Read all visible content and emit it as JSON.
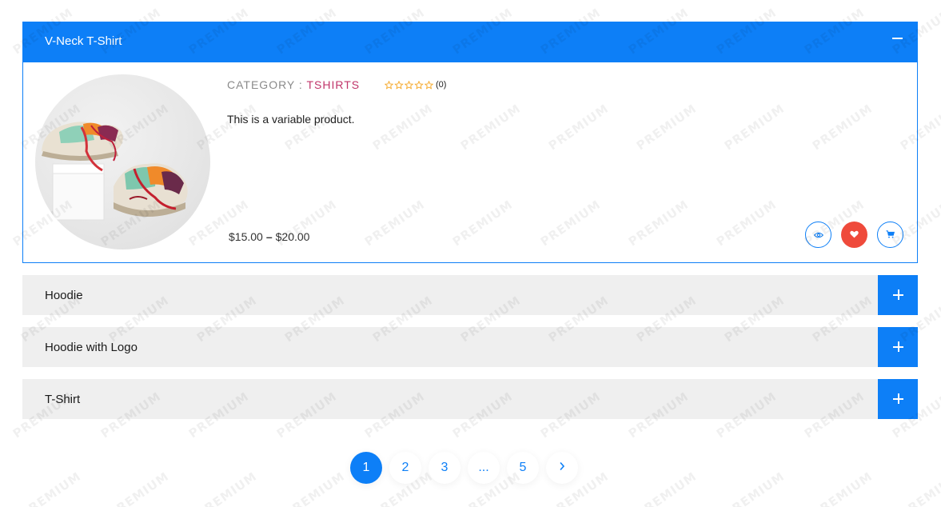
{
  "accordion": {
    "open_item": {
      "title": "V-Neck T-Shirt",
      "category_label": "CATEGORY :",
      "category_value": "TSHIRTS",
      "rating_count": "(0)",
      "description": "This is a variable product.",
      "price_low": "$15.00",
      "price_sep": "–",
      "price_high": "$20.00"
    },
    "closed_items": [
      {
        "title": "Hoodie"
      },
      {
        "title": "Hoodie with Logo"
      },
      {
        "title": "T-Shirt"
      }
    ]
  },
  "pagination": {
    "pages": [
      "1",
      "2",
      "3",
      "...",
      "5"
    ],
    "active": "1"
  },
  "watermark": "PREMIUM",
  "colors": {
    "accent": "#0d7ff7",
    "wishlist": "#ef4a3b",
    "category": "#c0356a",
    "star": "#f5a623"
  }
}
